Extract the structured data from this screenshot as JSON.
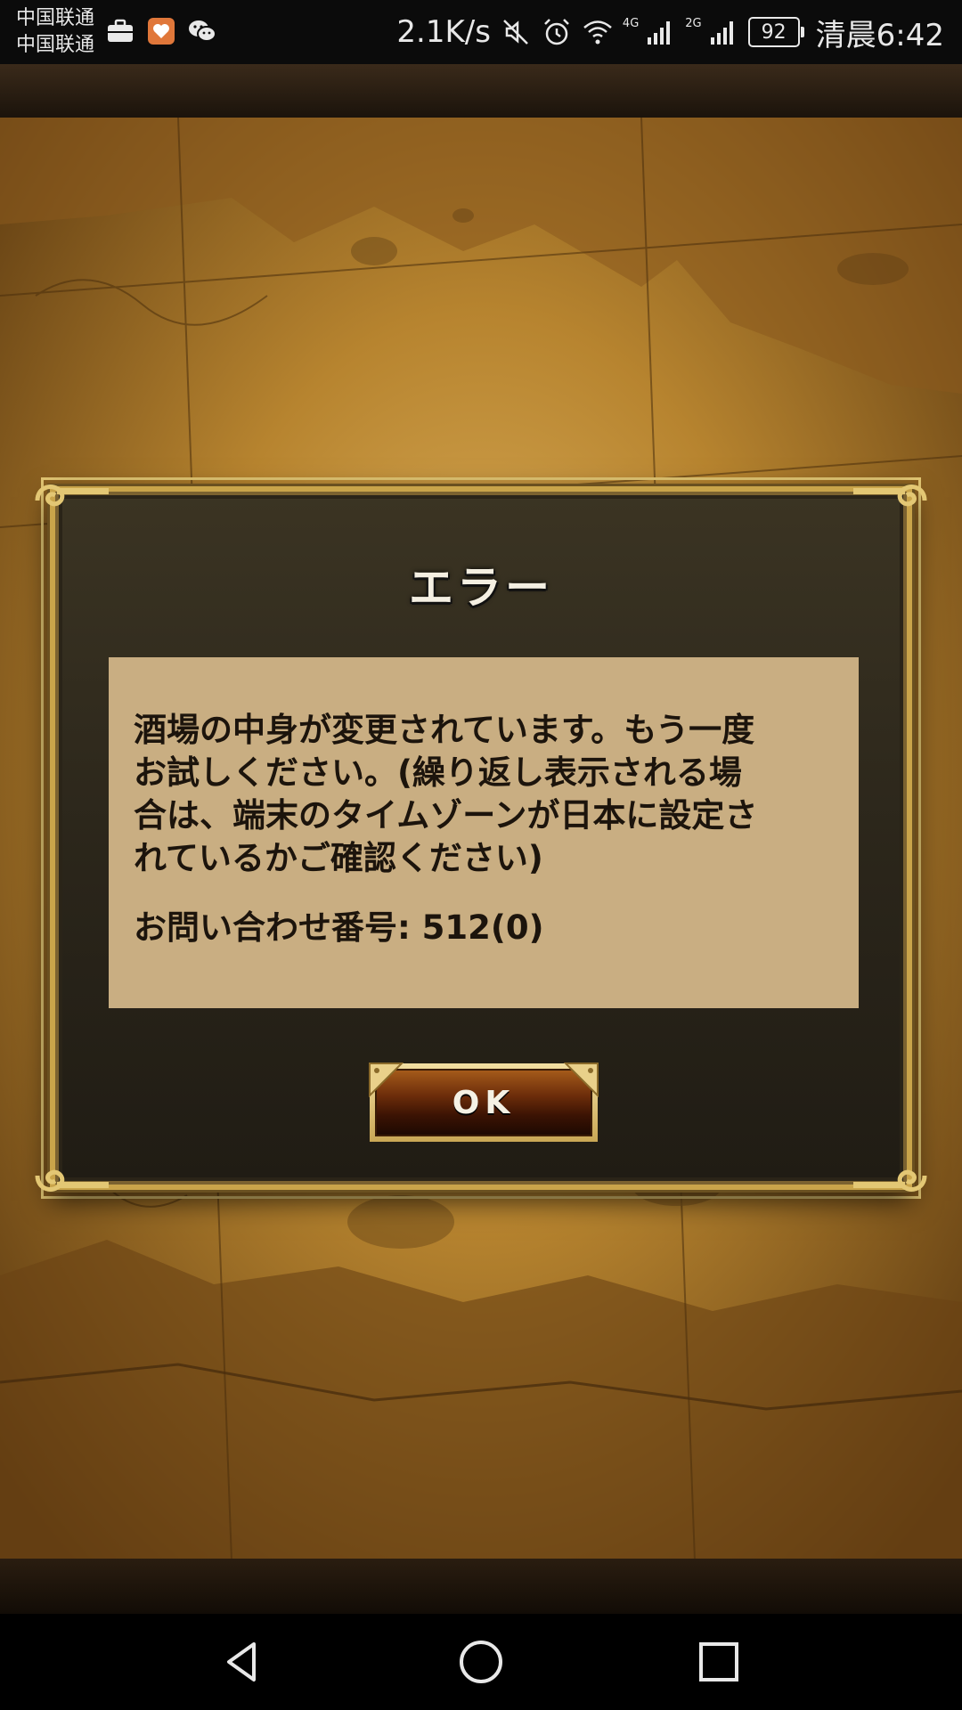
{
  "status_bar": {
    "carrier_1": "中国联通",
    "carrier_2": "中国联通",
    "notification_icons": [
      "briefcase-icon",
      "heart-app-icon",
      "wechat-icon"
    ],
    "net_speed": "2.1K/s",
    "signal_1_label": "4G",
    "signal_2_label": "2G",
    "battery_level": "92",
    "time": "清晨6:42"
  },
  "dialog": {
    "title": "エラー",
    "message_lines": [
      "酒場の中身が変更されています。もう一度",
      "お試しください。(繰り返し表示される場",
      "合は、端末のタイムゾーンが日本に設定さ",
      "れているかご確認ください)"
    ],
    "inquiry": "お問い合わせ番号: 512(0)",
    "ok_label": "OK"
  },
  "nav_bar": {
    "buttons": [
      "back-icon",
      "home-icon",
      "recents-icon"
    ]
  },
  "colors": {
    "frame_gold": "#c9a44a",
    "dialog_bg": "#2a251a",
    "message_bg": "#c9ae82",
    "ok_button": "#6b2c0a"
  }
}
